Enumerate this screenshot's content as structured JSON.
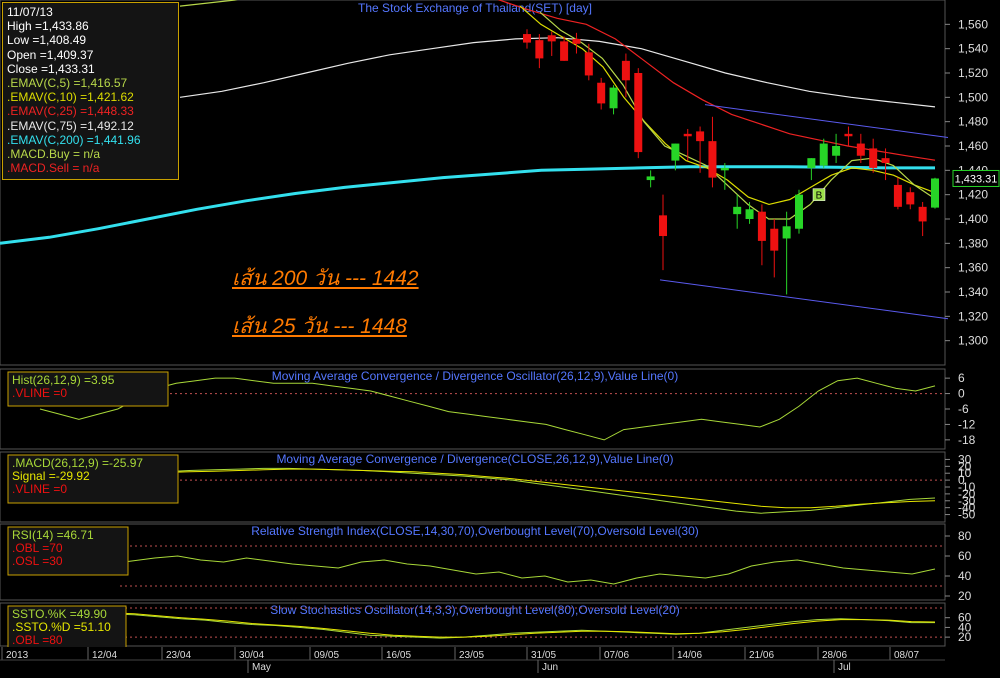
{
  "colors": {
    "up": "#27d527",
    "down": "#ee1111",
    "ema5": "#b8d84a",
    "ema10": "#dddd00",
    "ema25": "#ee2222",
    "ema75": "#e8e8e8",
    "ema200": "#33e0ee",
    "channel": "#5a5aee",
    "indicator": "#a8d838",
    "signal": "#e6e600",
    "threshold": "#c05050",
    "panel_border": "#c8a000",
    "grid": "#3a3a3a"
  },
  "info_box": {
    "date": "11/07/13",
    "high": "High  =1,433.86",
    "low": "Low  =1,408.49",
    "open": "Open  =1,409.37",
    "close": "Close  =1,433.31",
    "ema5": ".EMAV(C,5)  =1,416.57",
    "ema10": ".EMAV(C,10)  =1,421.62",
    "ema25": ".EMAV(C,25)  =1,448.33",
    "ema75": ".EMAV(C,75)  =1,492.12",
    "ema200": ".EMAV(C,200)  =1,441.96",
    "macd_buy": ".MACD.Buy  = n/a",
    "macd_sell": ".MACD.Sell  = n/a"
  },
  "annotations": {
    "line1": "เส้น 200 วัน --- 1442",
    "line2": "เส้น 25 วัน --- 1448"
  },
  "chart_data": [
    {
      "type": "candlestick",
      "title": "The Stock Exchange of Thailand(SET) [day]",
      "ylim": [
        1280,
        1580
      ],
      "y_ticks": [
        "1,300",
        "1,320",
        "1,340",
        "1,360",
        "1,380",
        "1,400",
        "1,420",
        "1,440",
        "1,460",
        "1,480",
        "1,500",
        "1,520",
        "1,540",
        "1,560"
      ],
      "last_price_label": "1,433.31",
      "marker_label": "B",
      "ohlc_visible": [
        [
          1552,
          1556,
          1540,
          1545
        ],
        [
          1547,
          1552,
          1524,
          1532
        ],
        [
          1551,
          1554,
          1534,
          1546
        ],
        [
          1546,
          1550,
          1530,
          1530
        ],
        [
          1548,
          1553,
          1536,
          1544
        ],
        [
          1537,
          1544,
          1514,
          1518
        ],
        [
          1512,
          1516,
          1490,
          1495
        ],
        [
          1491,
          1510,
          1486,
          1508
        ],
        [
          1530,
          1536,
          1500,
          1514
        ],
        [
          1520,
          1524,
          1450,
          1455
        ],
        [
          1432,
          1440,
          1426,
          1435
        ],
        [
          1403,
          1420,
          1358,
          1386
        ],
        [
          1448,
          1462,
          1440,
          1462
        ],
        [
          1470,
          1474,
          1448,
          1468
        ],
        [
          1472,
          1476,
          1438,
          1464
        ],
        [
          1464,
          1484,
          1426,
          1434
        ],
        [
          1440,
          1446,
          1424,
          1442
        ],
        [
          1404,
          1420,
          1392,
          1410
        ],
        [
          1400,
          1414,
          1396,
          1408
        ],
        [
          1406,
          1412,
          1362,
          1382
        ],
        [
          1392,
          1400,
          1352,
          1374
        ],
        [
          1384,
          1406,
          1338,
          1394
        ],
        [
          1392,
          1424,
          1388,
          1420
        ],
        [
          1442,
          1450,
          1432,
          1450
        ],
        [
          1444,
          1466,
          1442,
          1462
        ],
        [
          1452,
          1470,
          1446,
          1460
        ],
        [
          1470,
          1476,
          1460,
          1468
        ],
        [
          1462,
          1470,
          1446,
          1452
        ],
        [
          1458,
          1466,
          1438,
          1442
        ],
        [
          1450,
          1458,
          1432,
          1446
        ],
        [
          1428,
          1434,
          1408,
          1410
        ],
        [
          1422,
          1426,
          1408,
          1412
        ],
        [
          1410,
          1414,
          1386,
          1398
        ],
        [
          1409.37,
          1433.86,
          1408.49,
          1433.31
        ]
      ],
      "ema_values": {
        "ema5": 1416.57,
        "ema10": 1421.62,
        "ema25": 1448.33,
        "ema75": 1492.12,
        "ema200": 1441.96
      }
    },
    {
      "type": "line",
      "title": "Moving Average Convergence / Divergence Oscillator(26,12,9),Value Line(0)",
      "legend": [
        "Hist(26,12,9)  =3.95",
        ".VLINE  =0"
      ],
      "y_ticks": [
        "6",
        "0",
        "-6",
        "-12",
        "-18"
      ],
      "ylim": [
        -20,
        8
      ],
      "series": [
        {
          "name": "Hist(26,12,9)",
          "values": [
            -6,
            -8,
            -10,
            -8,
            -6,
            -2,
            2,
            4,
            5,
            6,
            6,
            5,
            4,
            4,
            4,
            3,
            2,
            1,
            -1,
            -3,
            -5,
            -7,
            -8,
            -9,
            -10,
            -11,
            -12,
            -14,
            -16,
            -18,
            -14,
            -13,
            -12,
            -11,
            -10,
            -11,
            -12,
            -13,
            -10,
            -5,
            1,
            5,
            6,
            4,
            2,
            1,
            3
          ]
        }
      ]
    },
    {
      "type": "line",
      "title": "Moving Average Convergence / Divergence(CLOSE,26,12,9),Value Line(0)",
      "legend": [
        ".MACD(26,12,9)  =-25.97",
        " Signal  =-29.92",
        ".VLINE  =0"
      ],
      "y_ticks": [
        "30",
        "20",
        "10",
        "0",
        "-10",
        "-20",
        "-30",
        "-40",
        "-50"
      ],
      "ylim": [
        -55,
        35
      ],
      "series": [
        {
          "name": "MACD(26,12,9)",
          "values": [
            0,
            3,
            5,
            8,
            10,
            12,
            14,
            15,
            16,
            17,
            17,
            16,
            15,
            14,
            12,
            10,
            8,
            6,
            3,
            0,
            -5,
            -10,
            -15,
            -20,
            -25,
            -30,
            -35,
            -40,
            -45,
            -48,
            -46,
            -44,
            -40,
            -36,
            -32,
            -28,
            -26
          ]
        },
        {
          "name": "Signal",
          "values": [
            2,
            4,
            6,
            8,
            10,
            11,
            12,
            13,
            14,
            15,
            16,
            16,
            15,
            14,
            13,
            12,
            10,
            8,
            5,
            2,
            -2,
            -6,
            -10,
            -14,
            -18,
            -22,
            -26,
            -30,
            -34,
            -38,
            -40,
            -40,
            -38,
            -35,
            -33,
            -31,
            -30
          ]
        }
      ]
    },
    {
      "type": "line",
      "title": "Relative Strength Index(CLOSE,14,30,70),Overbought Level(70),Oversold Level(30)",
      "legend": [
        "RSI(14)  =46.71",
        ".OBL  =70",
        ".OSL  =30"
      ],
      "y_ticks": [
        "80",
        "60",
        "40",
        "20"
      ],
      "ylim": [
        20,
        88
      ],
      "series": [
        {
          "name": "RSI(14)",
          "values": [
            45,
            42,
            48,
            52,
            55,
            58,
            60,
            56,
            54,
            58,
            55,
            52,
            50,
            48,
            54,
            56,
            52,
            50,
            46,
            42,
            44,
            38,
            40,
            34,
            36,
            32,
            38,
            42,
            40,
            38,
            42,
            50,
            54,
            56,
            52,
            48,
            46,
            44,
            42,
            47
          ]
        }
      ]
    },
    {
      "type": "line",
      "title": "Slow Stochastics Oscillator(14,3,3),Overbought Level(80),Oversold Level(20)",
      "legend": [
        "SSTO.%K  =49.90",
        ".SSTO.%D  =51.10",
        ".OBL  =80"
      ],
      "y_ticks": [
        "60",
        "40",
        "20"
      ],
      "ylim": [
        10,
        82
      ],
      "series": [
        {
          "name": "SSTO.%K",
          "values": [
            65,
            70,
            72,
            68,
            66,
            62,
            58,
            55,
            50,
            46,
            44,
            40,
            36,
            30,
            24,
            22,
            20,
            18,
            20,
            24,
            28,
            30,
            32,
            34,
            32,
            30,
            28,
            26,
            28,
            34,
            40,
            46,
            52,
            56,
            58,
            56,
            54,
            50,
            49.9
          ]
        },
        {
          "name": "SSTO.%D",
          "values": [
            62,
            66,
            70,
            70,
            68,
            64,
            60,
            57,
            53,
            48,
            45,
            42,
            38,
            33,
            28,
            24,
            22,
            20,
            20,
            22,
            25,
            28,
            30,
            32,
            32,
            31,
            29,
            27,
            28,
            31,
            36,
            42,
            48,
            53,
            56,
            56,
            55,
            52,
            51.1
          ]
        }
      ]
    },
    {
      "type": "axis",
      "x_tick_labels": [
        "2013",
        "12/04",
        "23/04",
        "30/04",
        "09/05",
        "16/05",
        "23/05",
        "31/05",
        "07/06",
        "14/06",
        "21/06",
        "28/06",
        "08/07"
      ],
      "month_labels": [
        "May",
        "Jun",
        "Jul"
      ]
    }
  ]
}
